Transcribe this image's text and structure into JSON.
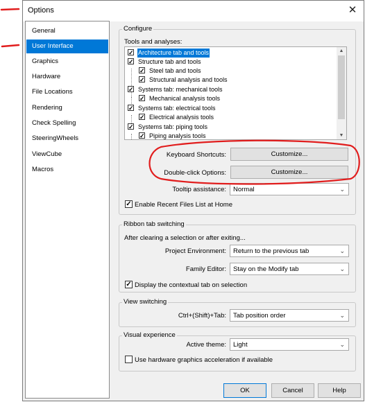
{
  "window": {
    "title": "Options",
    "close_glyph": "✕"
  },
  "sidebar": {
    "items": [
      {
        "label": "General",
        "selected": false
      },
      {
        "label": "User Interface",
        "selected": true
      },
      {
        "label": "Graphics",
        "selected": false
      },
      {
        "label": "Hardware",
        "selected": false
      },
      {
        "label": "File Locations",
        "selected": false
      },
      {
        "label": "Rendering",
        "selected": false
      },
      {
        "label": "Check Spelling",
        "selected": false
      },
      {
        "label": "SteeringWheels",
        "selected": false
      },
      {
        "label": "ViewCube",
        "selected": false
      },
      {
        "label": "Macros",
        "selected": false
      }
    ]
  },
  "configure": {
    "title": "Configure",
    "tools_label": "Tools and analyses:",
    "tree": [
      {
        "label": "Architecture tab and tools",
        "checked": true,
        "level": 0,
        "selected": true
      },
      {
        "label": "Structure tab and tools",
        "checked": true,
        "level": 0,
        "selected": false
      },
      {
        "label": "Steel tab and tools",
        "checked": true,
        "level": 1,
        "selected": false
      },
      {
        "label": "Structural analysis and tools",
        "checked": true,
        "level": 1,
        "selected": false
      },
      {
        "label": "Systems tab: mechanical tools",
        "checked": true,
        "level": 0,
        "selected": false
      },
      {
        "label": "Mechanical analysis tools",
        "checked": true,
        "level": 1,
        "selected": false
      },
      {
        "label": "Systems tab: electrical tools",
        "checked": true,
        "level": 0,
        "selected": false
      },
      {
        "label": "Electrical analysis tools",
        "checked": true,
        "level": 1,
        "selected": false
      },
      {
        "label": "Systems tab: piping tools",
        "checked": true,
        "level": 0,
        "selected": false
      },
      {
        "label": "Piping analysis tools",
        "checked": true,
        "level": 1,
        "selected": false
      }
    ],
    "keyboard_label": "Keyboard Shortcuts:",
    "keyboard_button": "Customize...",
    "doubleclick_label": "Double-click Options:",
    "doubleclick_button": "Customize...",
    "tooltip_label": "Tooltip assistance:",
    "tooltip_value": "Normal",
    "recent_files_label": "Enable Recent Files List at Home",
    "recent_files_checked": true
  },
  "ribbon": {
    "title": "Ribbon tab switching",
    "after_label": "After clearing a selection or after exiting...",
    "project_label": "Project Environment:",
    "project_value": "Return to the previous tab",
    "family_label": "Family Editor:",
    "family_value": "Stay on the Modify tab",
    "contextual_label": "Display the contextual tab on selection",
    "contextual_checked": true
  },
  "view_switching": {
    "title": "View switching",
    "shortcut_label": "Ctrl+(Shift)+Tab:",
    "shortcut_value": "Tab position order"
  },
  "visual": {
    "title": "Visual experience",
    "theme_label": "Active theme:",
    "theme_value": "Light",
    "hw_label": "Use hardware graphics acceleration if available",
    "hw_checked": false
  },
  "footer": {
    "ok": "OK",
    "cancel": "Cancel",
    "help": "Help"
  },
  "annotation": {
    "color": "#e11d1d"
  },
  "icons": {
    "check": "✓",
    "chevron": "⌄",
    "scroll_up": "▲",
    "scroll_down": "▼"
  }
}
